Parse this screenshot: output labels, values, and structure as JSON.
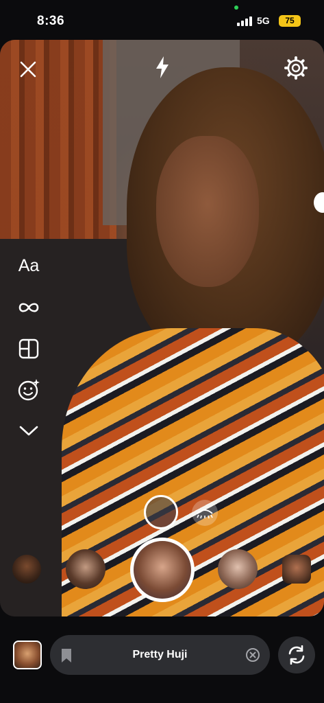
{
  "status_bar": {
    "time": "8:36",
    "network": "5G",
    "battery": "75",
    "battery_color": "#f5c518",
    "camera_indicator_color": "#2ed158"
  },
  "camera": {
    "top_icons": [
      "close-icon",
      "flash-icon",
      "gear-icon"
    ],
    "tools": [
      {
        "name": "text-tool",
        "label": "Aa"
      },
      {
        "name": "infinity-icon"
      },
      {
        "name": "layout-icon"
      },
      {
        "name": "face-effect-icon"
      },
      {
        "name": "chevron-down-icon"
      }
    ]
  },
  "bottom_bar": {
    "effect_name": "Pretty Huji",
    "pill_color": "#2d2e32"
  }
}
